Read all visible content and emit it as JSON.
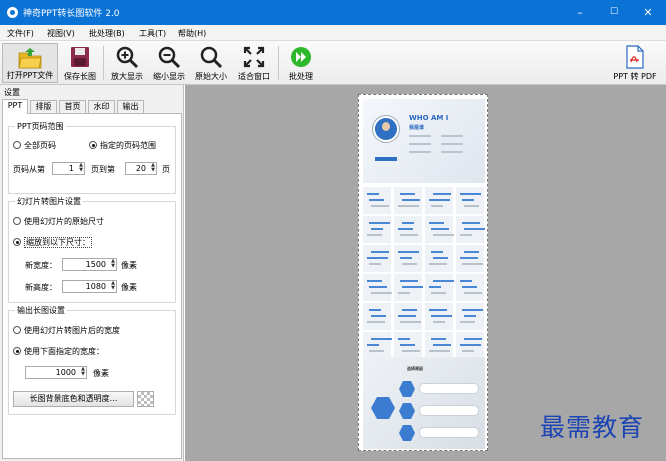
{
  "window": {
    "title": "神奇PPT转长图软件 2.0",
    "min": "–",
    "max": "☐",
    "close": "✕"
  },
  "menu": [
    "文件(F)",
    "视图(V)",
    "批处理(B)",
    "工具(T)",
    "帮助(H)"
  ],
  "toolbar": {
    "open": "打开PPT文件",
    "save": "保存长图",
    "zoom_in": "放大显示",
    "zoom_out": "缩小显示",
    "original": "原始大小",
    "fit": "适合窗口",
    "batch": "批处理",
    "to_pdf": "PPT 转 PDF"
  },
  "panel": {
    "title": "设置",
    "tabs": [
      "PPT",
      "排版",
      "首页",
      "水印",
      "输出"
    ],
    "page_range": {
      "title": "PPT页码范围",
      "all": "全部页码",
      "specified": "指定的页码范围",
      "from_label": "页码从第",
      "from_value": "1",
      "to_label": "页到第",
      "to_value": "20",
      "page_unit": "页"
    },
    "slide_image": {
      "title": "幻灯片转图片设置",
      "original_size": "使用幻灯片的原始尺寸",
      "scale_to": "缩放到以下尺寸：",
      "width_label": "新宽度：",
      "width_value": "1500",
      "height_label": "新高度：",
      "height_value": "1080",
      "unit": "像素"
    },
    "output": {
      "title": "输出长图设置",
      "use_converted_width": "使用幻灯片转图片后的宽度",
      "use_specified_width": "使用下面指定的宽度：",
      "width_value": "1000",
      "unit": "像素",
      "bg_button": "长图背景底色和透明度..."
    }
  },
  "preview": {
    "who_title": "WHO AM I",
    "who_subtitle": "我是谁",
    "bottom_title": "选择原因",
    "hex_label": "选择原因"
  },
  "watermark": "最需教育",
  "colors": {
    "title_bar": "#0b73d6",
    "accent": "#2a6ac0",
    "watermark": "#1c44b4",
    "preview_bg": "#a7a7a7"
  }
}
